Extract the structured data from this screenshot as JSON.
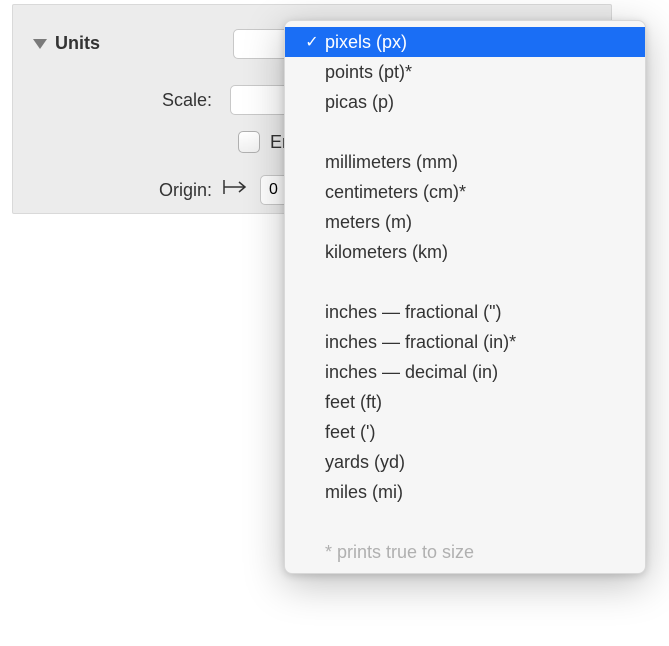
{
  "section": {
    "title": "Units"
  },
  "scale": {
    "label": "Scale:"
  },
  "enforce": {
    "label_visible": "En"
  },
  "origin": {
    "label": "Origin:",
    "value_visible": "0"
  },
  "units_menu": {
    "items": [
      {
        "label": "pixels (px)",
        "selected": true
      },
      {
        "label": "points (pt)*",
        "selected": false
      },
      {
        "label": "picas (p)",
        "selected": false
      }
    ],
    "metric": [
      {
        "label": "millimeters (mm)"
      },
      {
        "label": "centimeters (cm)*"
      },
      {
        "label": "meters (m)"
      },
      {
        "label": "kilometers (km)"
      }
    ],
    "imperial": [
      {
        "label": "inches — fractional (\")"
      },
      {
        "label": "inches — fractional (in)*"
      },
      {
        "label": "inches — decimal (in)"
      },
      {
        "label": "feet (ft)"
      },
      {
        "label": "feet (')"
      },
      {
        "label": "yards (yd)"
      },
      {
        "label": "miles (mi)"
      }
    ],
    "footnote": "* prints true to size",
    "checkmark": "✓"
  }
}
